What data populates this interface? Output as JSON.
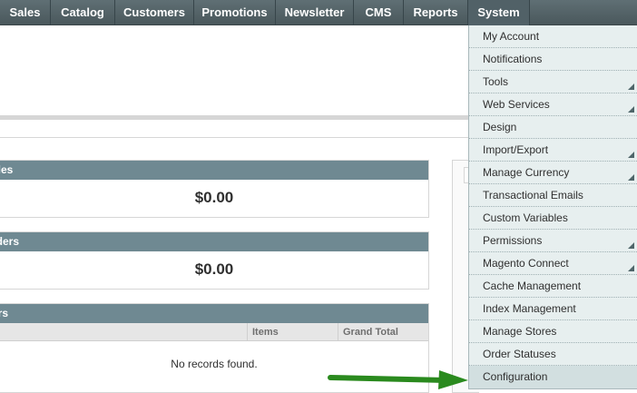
{
  "nav": {
    "items": [
      {
        "label": "Sales"
      },
      {
        "label": "Catalog"
      },
      {
        "label": "Customers"
      },
      {
        "label": "Promotions"
      },
      {
        "label": "Newsletter"
      },
      {
        "label": "CMS"
      },
      {
        "label": "Reports"
      },
      {
        "label": "System"
      }
    ],
    "active": "System"
  },
  "dashboard": {
    "lifetime_sales": {
      "title": "ales",
      "value": "$0.00"
    },
    "average_orders": {
      "title": "rders",
      "value": "$0.00"
    },
    "last_orders": {
      "title": "ers",
      "columns": [
        "Items",
        "Grand Total"
      ],
      "empty_text": "No records found."
    }
  },
  "system_menu": {
    "items": [
      {
        "label": "My Account",
        "submenu": false
      },
      {
        "label": "Notifications",
        "submenu": false
      },
      {
        "label": "Tools",
        "submenu": true
      },
      {
        "label": "Web Services",
        "submenu": true
      },
      {
        "label": "Design",
        "submenu": false
      },
      {
        "label": "Import/Export",
        "submenu": true
      },
      {
        "label": "Manage Currency",
        "submenu": true
      },
      {
        "label": "Transactional Emails",
        "submenu": false
      },
      {
        "label": "Custom Variables",
        "submenu": false
      },
      {
        "label": "Permissions",
        "submenu": true
      },
      {
        "label": "Magento Connect",
        "submenu": true
      },
      {
        "label": "Cache Management",
        "submenu": false
      },
      {
        "label": "Index Management",
        "submenu": false
      },
      {
        "label": "Manage Stores",
        "submenu": false
      },
      {
        "label": "Order Statuses",
        "submenu": false
      },
      {
        "label": "Configuration",
        "submenu": false
      }
    ],
    "highlighted": "Configuration"
  },
  "colors": {
    "nav_bg": "#4f5e63",
    "box_header": "#6f8992",
    "dropdown_bg": "#e7efef",
    "pointer_arrow": "#2a8a1e"
  }
}
